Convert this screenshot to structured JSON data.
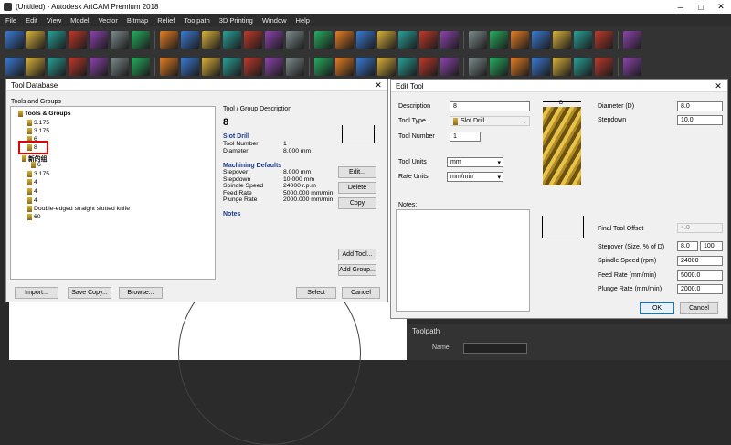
{
  "window": {
    "title": "(Untitled) - Autodesk ArtCAM Premium 2018",
    "minimize": "─",
    "maximize": "□",
    "close": "✕"
  },
  "menu": [
    "File",
    "Edit",
    "View",
    "Model",
    "Vector",
    "Bitmap",
    "Relief",
    "Toolpath",
    "3D Printing",
    "Window",
    "Help"
  ],
  "toolbar1_icons": [
    "new-icon",
    "open-icon",
    "save-icon",
    "cut-icon",
    "copy-icon",
    "paste-icon",
    "undo-icon",
    "redo-icon",
    "move-icon",
    "transform-icon",
    "pdf-icon",
    "sketch-icon",
    "measure-icon",
    "shading-icon",
    "wireframe-icon",
    "layers-icon",
    "folder-icon",
    "vector-icon",
    "node-icon",
    "star-icon",
    "offset-icon",
    "weave-icon",
    "box-icon",
    "frame-icon",
    "relief-icon",
    "texture-icon",
    "nodes-icon",
    "snap-icon",
    "curve-icon"
  ],
  "toolbar2_icons": [
    "view-fit-icon",
    "view-zoom-icon",
    "top-view-icon",
    "eraser-icon",
    "iso-view-icon",
    "front-view-icon",
    "grid-icon",
    "texture-view-icon",
    "note-icon",
    "left-view-icon",
    "right-view-icon",
    "relief-view-icon",
    "bitmap-view-icon",
    "terrain-icon",
    "rotate-icon",
    "sweep-icon",
    "layer-view-icon",
    "shadow-icon",
    "extrude-icon",
    "cone-icon",
    "sculpt-icon",
    "profile-icon",
    "pocket-icon",
    "drill-icon",
    "carve-icon",
    "plus-icon",
    "tool-icon",
    "engrave-icon",
    "machine-icon"
  ],
  "colors": {
    "accent": "#0078d7",
    "dark_ui": "#2b2b2b",
    "dialog_bg": "#f0f0f0",
    "highlight": "#e00000",
    "drill_gold": "#e8c34a"
  },
  "tool_db": {
    "title": "Tool Database",
    "close": "✕",
    "tools_groups_label": "Tools and Groups",
    "tree_root": "Tools & Groups",
    "tree_items": [
      "3.175",
      "3.175",
      "6",
      "8",
      "新的组",
      "6",
      "3.175",
      "4",
      "4",
      "4",
      "Double-edged straight slotted knife",
      "60"
    ],
    "desc_heading": "Tool / Group Description",
    "tool_number_big": "8",
    "tool_type": "Slot Drill",
    "info_rows": [
      [
        "Tool Number",
        "1"
      ],
      [
        "Diameter",
        "8.000 mm"
      ]
    ],
    "machining_heading": "Machining Defaults",
    "machining_rows": [
      [
        "Stepover",
        "8.000 mm"
      ],
      [
        "Stepdown",
        "10.000 mm"
      ],
      [
        "Spindle Speed",
        "24000 r.p.m"
      ],
      [
        "Feed Rate",
        "5000.000 mm/min"
      ],
      [
        "Plunge Rate",
        "2000.000 mm/min"
      ]
    ],
    "notes_heading": "Notes",
    "buttons": {
      "edit": "Edit...",
      "delete": "Delete",
      "copy": "Copy",
      "add_tool": "Add Tool...",
      "add_group": "Add Group...",
      "import": "Import...",
      "save_copy": "Save Copy...",
      "browse": "Browse...",
      "select": "Select",
      "cancel": "Cancel"
    }
  },
  "edit_tool": {
    "title": "Edit Tool",
    "close": "✕",
    "description_label": "Description",
    "description_value": "8",
    "tool_type_label": "Tool Type",
    "tool_type_value": "Slot Drill",
    "tool_number_label": "Tool Number",
    "tool_number_value": "1",
    "tool_units_label": "Tool Units",
    "tool_units_value": "mm",
    "rate_units_label": "Rate Units",
    "rate_units_value": "mm/min",
    "notes_label": "Notes:",
    "dim_label": "D",
    "diameter_label": "Diameter (D)",
    "diameter_value": "8.0",
    "stepdown_label": "Stepdown",
    "stepdown_value": "10.0",
    "final_offset_label": "Final Tool Offset",
    "final_offset_value": "4.0",
    "stepover_label": "Stepover (Size, % of D)",
    "stepover_value": "8.0",
    "stepover_percent": "100",
    "spindle_label": "Spindle Speed (rpm)",
    "spindle_value": "24000",
    "feed_label": "Feed Rate (mm/min)",
    "feed_value": "5000.0",
    "plunge_label": "Plunge Rate (mm/min)",
    "plunge_value": "2000.0",
    "ok": "OK",
    "cancel": "Cancel"
  },
  "toolpath_panel": {
    "title": "Toolpath",
    "name_label": "Name:"
  }
}
